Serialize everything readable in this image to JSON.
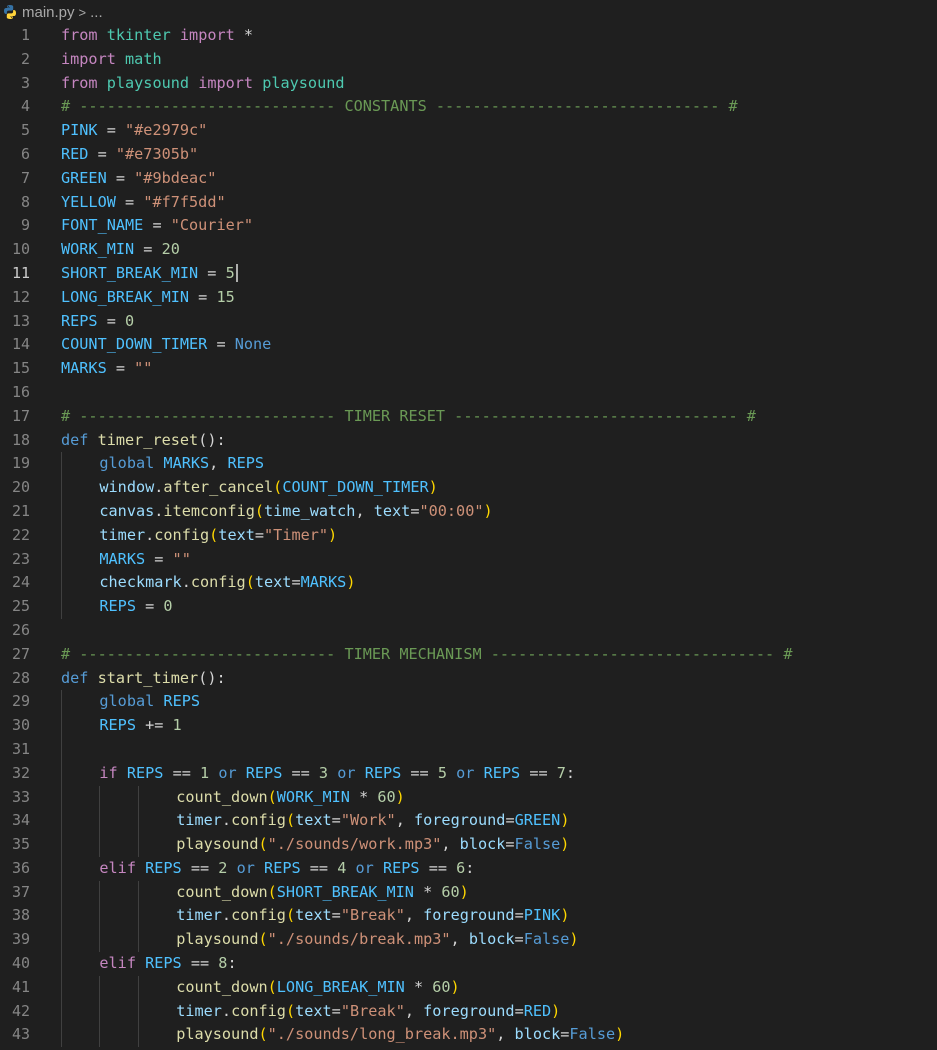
{
  "breadcrumb": {
    "file": "main.py",
    "separator": ">",
    "rest": "..."
  },
  "active_line": 11,
  "cursor": {
    "line": 11
  },
  "colors": {
    "background": "#1f1f1f",
    "line_number": "#858585"
  },
  "lines": [
    {
      "n": "1",
      "indent": 0,
      "tokens": [
        [
          "kw",
          "from"
        ],
        [
          "p",
          " "
        ],
        [
          "ns",
          "tkinter"
        ],
        [
          "p",
          " "
        ],
        [
          "kw",
          "import"
        ],
        [
          "p",
          " *"
        ]
      ]
    },
    {
      "n": "2",
      "indent": 0,
      "tokens": [
        [
          "kw",
          "import"
        ],
        [
          "p",
          " "
        ],
        [
          "ns",
          "math"
        ]
      ]
    },
    {
      "n": "3",
      "indent": 0,
      "tokens": [
        [
          "kw",
          "from"
        ],
        [
          "p",
          " "
        ],
        [
          "ns",
          "playsound"
        ],
        [
          "p",
          " "
        ],
        [
          "kw",
          "import"
        ],
        [
          "p",
          " "
        ],
        [
          "ns",
          "playsound"
        ]
      ]
    },
    {
      "n": "4",
      "indent": 0,
      "tokens": [
        [
          "cmt",
          "# ---------------------------- CONSTANTS ------------------------------- #"
        ]
      ]
    },
    {
      "n": "5",
      "indent": 0,
      "tokens": [
        [
          "var",
          "PINK"
        ],
        [
          "p",
          " = "
        ],
        [
          "str",
          "\"#e2979c\""
        ]
      ]
    },
    {
      "n": "6",
      "indent": 0,
      "tokens": [
        [
          "var",
          "RED"
        ],
        [
          "p",
          " = "
        ],
        [
          "str",
          "\"#e7305b\""
        ]
      ]
    },
    {
      "n": "7",
      "indent": 0,
      "tokens": [
        [
          "var",
          "GREEN"
        ],
        [
          "p",
          " = "
        ],
        [
          "str",
          "\"#9bdeac\""
        ]
      ]
    },
    {
      "n": "8",
      "indent": 0,
      "tokens": [
        [
          "var",
          "YELLOW"
        ],
        [
          "p",
          " = "
        ],
        [
          "str",
          "\"#f7f5dd\""
        ]
      ]
    },
    {
      "n": "9",
      "indent": 0,
      "tokens": [
        [
          "var",
          "FONT_NAME"
        ],
        [
          "p",
          " = "
        ],
        [
          "str",
          "\"Courier\""
        ]
      ]
    },
    {
      "n": "10",
      "indent": 0,
      "tokens": [
        [
          "var",
          "WORK_MIN"
        ],
        [
          "p",
          " = "
        ],
        [
          "num",
          "20"
        ]
      ]
    },
    {
      "n": "11",
      "indent": 0,
      "tokens": [
        [
          "var",
          "SHORT_BREAK_MIN"
        ],
        [
          "p",
          " = "
        ],
        [
          "num",
          "5"
        ]
      ]
    },
    {
      "n": "12",
      "indent": 0,
      "tokens": [
        [
          "var",
          "LONG_BREAK_MIN"
        ],
        [
          "p",
          " = "
        ],
        [
          "num",
          "15"
        ]
      ]
    },
    {
      "n": "13",
      "indent": 0,
      "tokens": [
        [
          "var",
          "REPS"
        ],
        [
          "p",
          " = "
        ],
        [
          "num",
          "0"
        ]
      ]
    },
    {
      "n": "14",
      "indent": 0,
      "tokens": [
        [
          "var",
          "COUNT_DOWN_TIMER"
        ],
        [
          "p",
          " = "
        ],
        [
          "def",
          "None"
        ]
      ]
    },
    {
      "n": "15",
      "indent": 0,
      "tokens": [
        [
          "var",
          "MARKS"
        ],
        [
          "p",
          " = "
        ],
        [
          "str",
          "\"\""
        ]
      ]
    },
    {
      "n": "16",
      "indent": 0,
      "tokens": []
    },
    {
      "n": "17",
      "indent": 0,
      "tokens": [
        [
          "cmt",
          "# ---------------------------- TIMER RESET ------------------------------- #"
        ]
      ]
    },
    {
      "n": "18",
      "indent": 0,
      "tokens": [
        [
          "def",
          "def"
        ],
        [
          "p",
          " "
        ],
        [
          "fn",
          "timer_reset"
        ],
        [
          "p",
          "():"
        ]
      ]
    },
    {
      "n": "19",
      "indent": 1,
      "tokens": [
        [
          "def",
          "global"
        ],
        [
          "p",
          " "
        ],
        [
          "var",
          "MARKS"
        ],
        [
          "p",
          ", "
        ],
        [
          "var",
          "REPS"
        ]
      ]
    },
    {
      "n": "20",
      "indent": 1,
      "tokens": [
        [
          "par",
          "window"
        ],
        [
          "p",
          "."
        ],
        [
          "fn",
          "after_cancel"
        ],
        [
          "p1",
          "("
        ],
        [
          "var",
          "COUNT_DOWN_TIMER"
        ],
        [
          "p1",
          ")"
        ]
      ]
    },
    {
      "n": "21",
      "indent": 1,
      "tokens": [
        [
          "par",
          "canvas"
        ],
        [
          "p",
          "."
        ],
        [
          "fn",
          "itemconfig"
        ],
        [
          "p1",
          "("
        ],
        [
          "par",
          "time_watch"
        ],
        [
          "p",
          ", "
        ],
        [
          "par",
          "text"
        ],
        [
          "p",
          "="
        ],
        [
          "str",
          "\"00:00\""
        ],
        [
          "p1",
          ")"
        ]
      ]
    },
    {
      "n": "22",
      "indent": 1,
      "tokens": [
        [
          "par",
          "timer"
        ],
        [
          "p",
          "."
        ],
        [
          "fn",
          "config"
        ],
        [
          "p1",
          "("
        ],
        [
          "par",
          "text"
        ],
        [
          "p",
          "="
        ],
        [
          "str",
          "\"Timer\""
        ],
        [
          "p1",
          ")"
        ]
      ]
    },
    {
      "n": "23",
      "indent": 1,
      "tokens": [
        [
          "var",
          "MARKS"
        ],
        [
          "p",
          " = "
        ],
        [
          "str",
          "\"\""
        ]
      ]
    },
    {
      "n": "24",
      "indent": 1,
      "tokens": [
        [
          "par",
          "checkmark"
        ],
        [
          "p",
          "."
        ],
        [
          "fn",
          "config"
        ],
        [
          "p1",
          "("
        ],
        [
          "par",
          "text"
        ],
        [
          "p",
          "="
        ],
        [
          "var",
          "MARKS"
        ],
        [
          "p1",
          ")"
        ]
      ]
    },
    {
      "n": "25",
      "indent": 1,
      "tokens": [
        [
          "var",
          "REPS"
        ],
        [
          "p",
          " = "
        ],
        [
          "num",
          "0"
        ]
      ]
    },
    {
      "n": "26",
      "indent": 0,
      "tokens": []
    },
    {
      "n": "27",
      "indent": 0,
      "tokens": [
        [
          "cmt",
          "# ---------------------------- TIMER MECHANISM ------------------------------- #"
        ]
      ]
    },
    {
      "n": "28",
      "indent": 0,
      "tokens": [
        [
          "def",
          "def"
        ],
        [
          "p",
          " "
        ],
        [
          "fn",
          "start_timer"
        ],
        [
          "p",
          "():"
        ]
      ]
    },
    {
      "n": "29",
      "indent": 1,
      "tokens": [
        [
          "def",
          "global"
        ],
        [
          "p",
          " "
        ],
        [
          "var",
          "REPS"
        ]
      ]
    },
    {
      "n": "30",
      "indent": 1,
      "tokens": [
        [
          "var",
          "REPS"
        ],
        [
          "p",
          " += "
        ],
        [
          "num",
          "1"
        ]
      ]
    },
    {
      "n": "31",
      "indent": 1,
      "tokens": []
    },
    {
      "n": "32",
      "indent": 1,
      "tokens": [
        [
          "kw",
          "if"
        ],
        [
          "p",
          " "
        ],
        [
          "var",
          "REPS"
        ],
        [
          "p",
          " == "
        ],
        [
          "num",
          "1"
        ],
        [
          "p",
          " "
        ],
        [
          "def",
          "or"
        ],
        [
          "p",
          " "
        ],
        [
          "var",
          "REPS"
        ],
        [
          "p",
          " == "
        ],
        [
          "num",
          "3"
        ],
        [
          "p",
          " "
        ],
        [
          "def",
          "or"
        ],
        [
          "p",
          " "
        ],
        [
          "var",
          "REPS"
        ],
        [
          "p",
          " == "
        ],
        [
          "num",
          "5"
        ],
        [
          "p",
          " "
        ],
        [
          "def",
          "or"
        ],
        [
          "p",
          " "
        ],
        [
          "var",
          "REPS"
        ],
        [
          "p",
          " == "
        ],
        [
          "num",
          "7"
        ],
        [
          "p",
          ":"
        ]
      ]
    },
    {
      "n": "33",
      "indent": 3,
      "tokens": [
        [
          "fn",
          "count_down"
        ],
        [
          "p1",
          "("
        ],
        [
          "var",
          "WORK_MIN"
        ],
        [
          "p",
          " * "
        ],
        [
          "num",
          "60"
        ],
        [
          "p1",
          ")"
        ]
      ]
    },
    {
      "n": "34",
      "indent": 3,
      "tokens": [
        [
          "par",
          "timer"
        ],
        [
          "p",
          "."
        ],
        [
          "fn",
          "config"
        ],
        [
          "p1",
          "("
        ],
        [
          "par",
          "text"
        ],
        [
          "p",
          "="
        ],
        [
          "str",
          "\"Work\""
        ],
        [
          "p",
          ", "
        ],
        [
          "par",
          "foreground"
        ],
        [
          "p",
          "="
        ],
        [
          "var",
          "GREEN"
        ],
        [
          "p1",
          ")"
        ]
      ]
    },
    {
      "n": "35",
      "indent": 3,
      "tokens": [
        [
          "fn",
          "playsound"
        ],
        [
          "p1",
          "("
        ],
        [
          "str",
          "\"./sounds/work.mp3\""
        ],
        [
          "p",
          ", "
        ],
        [
          "par",
          "block"
        ],
        [
          "p",
          "="
        ],
        [
          "def",
          "False"
        ],
        [
          "p1",
          ")"
        ]
      ]
    },
    {
      "n": "36",
      "indent": 1,
      "tokens": [
        [
          "kw",
          "elif"
        ],
        [
          "p",
          " "
        ],
        [
          "var",
          "REPS"
        ],
        [
          "p",
          " == "
        ],
        [
          "num",
          "2"
        ],
        [
          "p",
          " "
        ],
        [
          "def",
          "or"
        ],
        [
          "p",
          " "
        ],
        [
          "var",
          "REPS"
        ],
        [
          "p",
          " == "
        ],
        [
          "num",
          "4"
        ],
        [
          "p",
          " "
        ],
        [
          "def",
          "or"
        ],
        [
          "p",
          " "
        ],
        [
          "var",
          "REPS"
        ],
        [
          "p",
          " == "
        ],
        [
          "num",
          "6"
        ],
        [
          "p",
          ":"
        ]
      ]
    },
    {
      "n": "37",
      "indent": 3,
      "tokens": [
        [
          "fn",
          "count_down"
        ],
        [
          "p1",
          "("
        ],
        [
          "var",
          "SHORT_BREAK_MIN"
        ],
        [
          "p",
          " * "
        ],
        [
          "num",
          "60"
        ],
        [
          "p1",
          ")"
        ]
      ]
    },
    {
      "n": "38",
      "indent": 3,
      "tokens": [
        [
          "par",
          "timer"
        ],
        [
          "p",
          "."
        ],
        [
          "fn",
          "config"
        ],
        [
          "p1",
          "("
        ],
        [
          "par",
          "text"
        ],
        [
          "p",
          "="
        ],
        [
          "str",
          "\"Break\""
        ],
        [
          "p",
          ", "
        ],
        [
          "par",
          "foreground"
        ],
        [
          "p",
          "="
        ],
        [
          "var",
          "PINK"
        ],
        [
          "p1",
          ")"
        ]
      ]
    },
    {
      "n": "39",
      "indent": 3,
      "tokens": [
        [
          "fn",
          "playsound"
        ],
        [
          "p1",
          "("
        ],
        [
          "str",
          "\"./sounds/break.mp3\""
        ],
        [
          "p",
          ", "
        ],
        [
          "par",
          "block"
        ],
        [
          "p",
          "="
        ],
        [
          "def",
          "False"
        ],
        [
          "p1",
          ")"
        ]
      ]
    },
    {
      "n": "40",
      "indent": 1,
      "tokens": [
        [
          "kw",
          "elif"
        ],
        [
          "p",
          " "
        ],
        [
          "var",
          "REPS"
        ],
        [
          "p",
          " == "
        ],
        [
          "num",
          "8"
        ],
        [
          "p",
          ":"
        ]
      ]
    },
    {
      "n": "41",
      "indent": 3,
      "tokens": [
        [
          "fn",
          "count_down"
        ],
        [
          "p1",
          "("
        ],
        [
          "var",
          "LONG_BREAK_MIN"
        ],
        [
          "p",
          " * "
        ],
        [
          "num",
          "60"
        ],
        [
          "p1",
          ")"
        ]
      ]
    },
    {
      "n": "42",
      "indent": 3,
      "tokens": [
        [
          "par",
          "timer"
        ],
        [
          "p",
          "."
        ],
        [
          "fn",
          "config"
        ],
        [
          "p1",
          "("
        ],
        [
          "par",
          "text"
        ],
        [
          "p",
          "="
        ],
        [
          "str",
          "\"Break\""
        ],
        [
          "p",
          ", "
        ],
        [
          "par",
          "foreground"
        ],
        [
          "p",
          "="
        ],
        [
          "var",
          "RED"
        ],
        [
          "p1",
          ")"
        ]
      ]
    },
    {
      "n": "43",
      "indent": 3,
      "tokens": [
        [
          "fn",
          "playsound"
        ],
        [
          "p1",
          "("
        ],
        [
          "str",
          "\"./sounds/long_break.mp3\""
        ],
        [
          "p",
          ", "
        ],
        [
          "par",
          "block"
        ],
        [
          "p",
          "="
        ],
        [
          "def",
          "False"
        ],
        [
          "p1",
          ")"
        ]
      ]
    }
  ]
}
